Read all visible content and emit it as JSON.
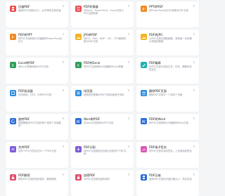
{
  "cards": [
    {
      "title": "压缩PDF",
      "desc": "缩减PDF文档的大小，且不降低文档质量",
      "icon": "compress-icon",
      "color": "#ef4f4f"
    },
    {
      "title": "PDF转换器",
      "desc": "将Word、PowerPoint、Excel文档与PDF互相转换",
      "icon": "converter-icon",
      "color": "#ef4f4f"
    },
    {
      "title": "PPT转PDF",
      "desc": "将PowerPoint幻灯片转换为PDF文档",
      "icon": "ppt-icon",
      "color": "#f08a24"
    },
    {
      "title": "PDF转PPT",
      "desc": "把PDF文档转换为可编辑的PowerPoint幻灯片",
      "icon": "ppt-icon",
      "color": "#f08a24"
    },
    {
      "title": "JPG转PDF",
      "desc": "将JPG、PNG、BMP、GIF、TIFF图像转换为PDF文档",
      "icon": "image-icon",
      "color": "#f5b323"
    },
    {
      "title": "PDF转JPG",
      "desc": "从PDF文档中提取图像，或将每一页转换为单独的图像",
      "icon": "image-icon",
      "color": "#f5b323"
    },
    {
      "title": "Excel转PDF",
      "desc": "将Excel表格转换为PDF文档",
      "icon": "excel-icon",
      "color": "#2e9e5b"
    },
    {
      "title": "PDF转Excel",
      "desc": "将PDF文档转换为可编辑的Excel表格",
      "icon": "excel-icon",
      "color": "#2e9e5b"
    },
    {
      "title": "PDF编辑",
      "desc": "在PDF文档中添加文本、形状、图像和手绘标注",
      "icon": "edit-icon",
      "color": "#1fb3b3"
    },
    {
      "title": "PDF阅读器",
      "desc": "在线阅读，打印，分享PDF文档",
      "icon": "reader-icon",
      "color": "#2f8fe0"
    },
    {
      "title": "排页面",
      "desc": "按照您的需要对PDF中的页面进行排序",
      "icon": "sort-icon",
      "color": "#2f8fe0"
    },
    {
      "title": "删除PDF页面",
      "desc": "删除PDF文档中一个或多个页面",
      "icon": "delete-icon",
      "color": "#2f8fe0"
    },
    {
      "title": "旋转PDF",
      "desc": "根据需要将PDF文档的单个或多个页面旋转",
      "icon": "rotate-icon",
      "color": "#2f6fd8"
    },
    {
      "title": "Word转PDF",
      "desc": "将Word文档转换为PDF文档",
      "icon": "word-icon",
      "color": "#2f6fd8"
    },
    {
      "title": "PDF转Word",
      "desc": "将PDF文档转换为可编辑的Word文档",
      "icon": "word-icon",
      "color": "#2f6fd8"
    },
    {
      "title": "合并PDF",
      "desc": "将多个PDF文档合并为一个PDF文档",
      "icon": "merge-icon",
      "color": "#7c5cd8"
    },
    {
      "title": "PDF分割",
      "desc": "将PDF文档按指定页面分割成多个PDF文档",
      "icon": "split-icon",
      "color": "#7c5cd8"
    },
    {
      "title": "PDF电子签名",
      "desc": "在PDF文档中添加签名，上传或绘制签名",
      "icon": "signature-icon",
      "color": "#d85ab5"
    },
    {
      "title": "PDF解密",
      "desc": "移除PDF文档的密码保护，解除限制",
      "icon": "unlock-icon",
      "color": "#e04f6d"
    },
    {
      "title": "加密PDF",
      "desc": "为PDF文档添加密码保护",
      "icon": "lock-icon",
      "color": "#e04f6d"
    },
    {
      "title": "PDF压缩",
      "desc": "使用PDF文档的页面压缩大小，然后导出",
      "icon": "compress-icon",
      "color": "#2f6fd8"
    }
  ]
}
